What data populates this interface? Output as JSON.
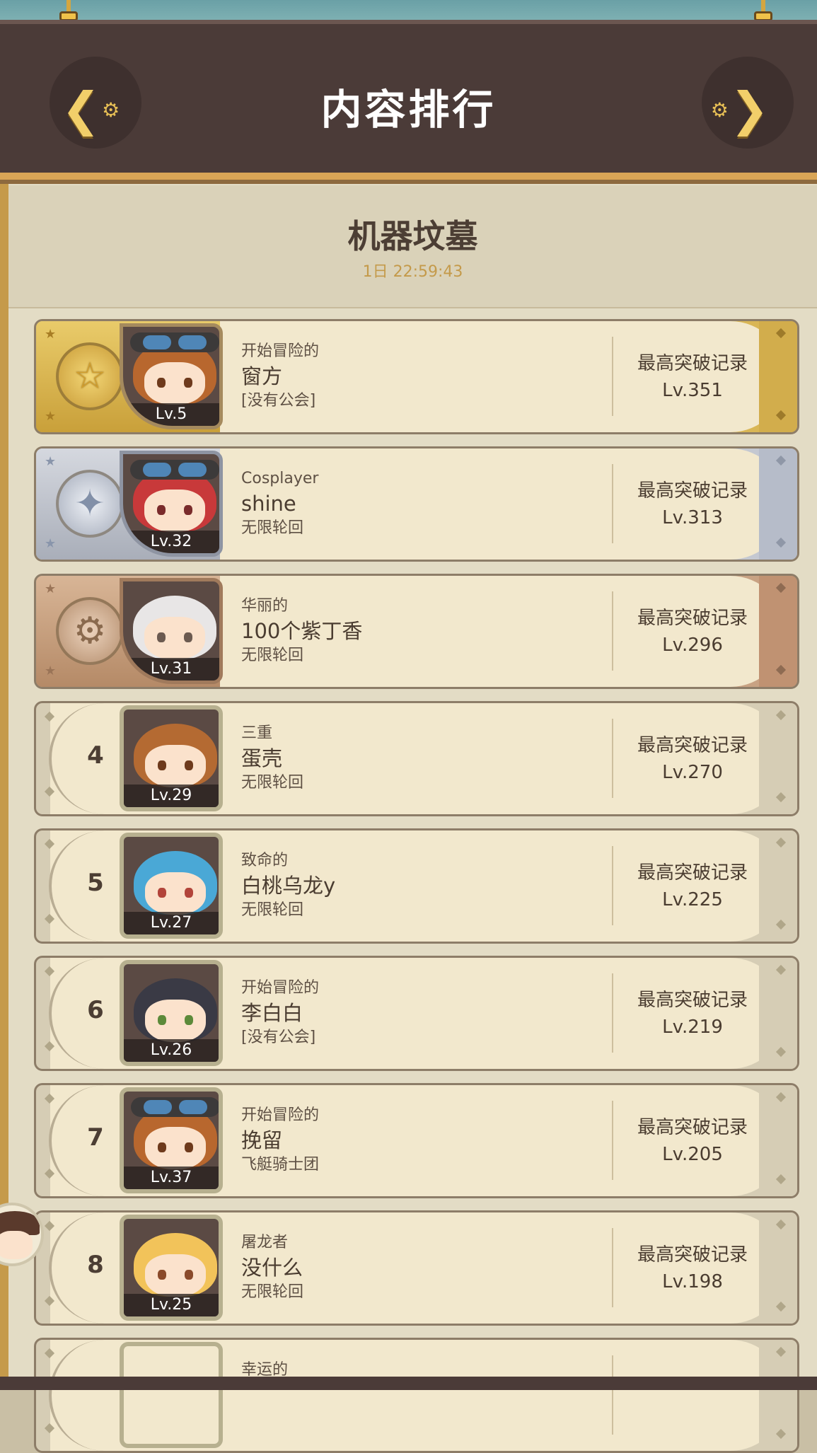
{
  "header": {
    "title": "内容排行",
    "prev_icon": "chevron-left-gear-icon",
    "next_icon": "chevron-right-gear-icon"
  },
  "event": {
    "name": "机器坟墓",
    "time_left": "1日 22:59:43"
  },
  "colors": {
    "header_bg": "#4b3b38",
    "accent_gold": "#d9a556",
    "panel_bg": "#e3dcc5",
    "row_cream": "#f2e8cd",
    "text_dark": "#4a3c30"
  },
  "record_label": "最高突破记录",
  "rankings": [
    {
      "rank": "1",
      "tier": "gold",
      "medal_icon": "star-medal-icon",
      "level": "Lv.5",
      "title": "开始冒险的",
      "name": "窗方",
      "guild": "[没有公会]",
      "record": "Lv.351",
      "hair": "#b8672e",
      "eye": "#6e3a1c",
      "goggles": true
    },
    {
      "rank": "2",
      "tier": "silver",
      "medal_icon": "compass-star-medal-icon",
      "level": "Lv.32",
      "title": "Cosplayer",
      "name": "shine",
      "guild": "无限轮回",
      "record": "Lv.313",
      "hair": "#c8393a",
      "eye": "#7a2b2b",
      "goggles": true
    },
    {
      "rank": "3",
      "tier": "bronze",
      "medal_icon": "gear-medal-icon",
      "level": "Lv.31",
      "title": "华丽的",
      "name": "100个紫丁香",
      "guild": "无限轮回",
      "record": "Lv.296",
      "hair": "#e8e6e6",
      "eye": "#6b5a50",
      "goggles": false
    },
    {
      "rank": "4",
      "tier": "plain",
      "level": "Lv.29",
      "title": "三重",
      "name": "蛋壳",
      "guild": "无限轮回",
      "record": "Lv.270",
      "hair": "#b46a32",
      "eye": "#6e3a1c",
      "goggles": false
    },
    {
      "rank": "5",
      "tier": "plain",
      "level": "Lv.27",
      "title": "致命的",
      "name": "白桃乌龙y",
      "guild": "无限轮回",
      "record": "Lv.225",
      "hair": "#4aa8d6",
      "eye": "#b2443a",
      "goggles": false
    },
    {
      "rank": "6",
      "tier": "plain",
      "level": "Lv.26",
      "title": "开始冒险的",
      "name": "李白白",
      "guild": "[没有公会]",
      "record": "Lv.219",
      "hair": "#3a3a45",
      "eye": "#5c8a3a",
      "goggles": false
    },
    {
      "rank": "7",
      "tier": "plain",
      "level": "Lv.37",
      "title": "开始冒险的",
      "name": "挽留",
      "guild": "飞艇骑士团",
      "record": "Lv.205",
      "hair": "#b8672e",
      "eye": "#6e3a1c",
      "goggles": true
    },
    {
      "rank": "8",
      "tier": "plain",
      "level": "Lv.25",
      "title": "屠龙者",
      "name": "没什么",
      "guild": "无限轮回",
      "record": "Lv.198",
      "hair": "#f2c35a",
      "eye": "#8a4a2a",
      "goggles": false
    },
    {
      "rank": "",
      "tier": "plain",
      "level": "",
      "title": "幸运的",
      "name": "",
      "guild": "",
      "record": "",
      "hair": "#f2e8cd",
      "eye": "#f2e8cd",
      "goggles": false
    }
  ]
}
